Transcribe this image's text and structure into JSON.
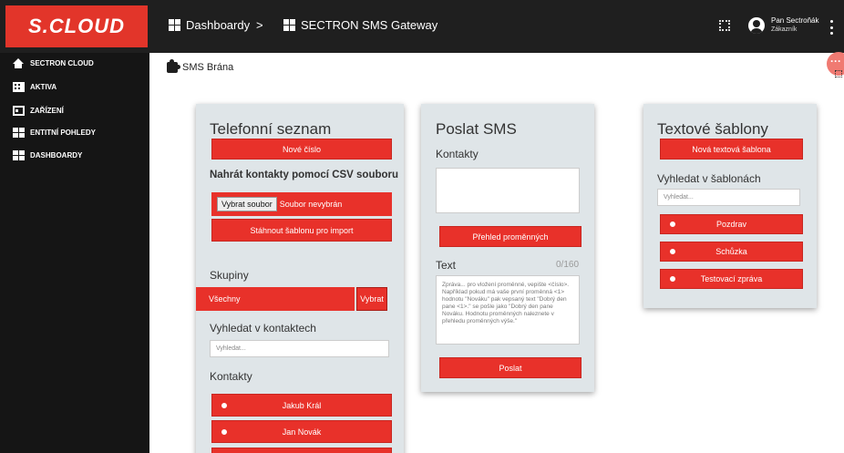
{
  "topbar": {
    "logo_text": "S.CLOUD",
    "crumb1": "Dashboardy",
    "separator": ">",
    "crumb2": "SECTRON SMS Gateway",
    "user_name": "Pan Sectroňák",
    "user_role": "Zákazník"
  },
  "sidebar": {
    "items": [
      {
        "label": "SECTRON CLOUD",
        "icon": "home-icon"
      },
      {
        "label": "AKTIVA",
        "icon": "building-icon"
      },
      {
        "label": "ZAŘÍZENÍ",
        "icon": "device-icon"
      },
      {
        "label": "ENTITNÍ POHLEDY",
        "icon": "entity-icon"
      },
      {
        "label": "DASHBOARDY",
        "icon": "dashboard-icon"
      }
    ]
  },
  "page": {
    "breadcrumb": "SMS Brána"
  },
  "phonebook": {
    "title": "Telefonní seznam",
    "new_number": "Nové číslo",
    "csv_label": "Nahrát kontakty pomocí CSV souboru",
    "choose_file": "Vybrat soubor",
    "file_status": "Soubor nevybrán",
    "download_template": "Stáhnout šablonu pro import",
    "groups_label": "Skupiny",
    "group_selected": "Všechny",
    "group_select_btn": "Vybrat",
    "search_label": "Vyhledat v kontaktech",
    "search_placeholder": "Vyhledat...",
    "contacts_label": "Kontakty",
    "contacts": [
      "Jakub Král",
      "Jan Novák"
    ]
  },
  "send_sms": {
    "title": "Poslat SMS",
    "contacts_label": "Kontakty",
    "variables_btn": "Přehled proměnných",
    "text_label": "Text",
    "counter": "0/160",
    "text_placeholder": "Zpráva... pro vložení proměnné, vepište <číslo>. Například pokud má vaše první proměnná <1> hodnotu \"Nováku\" pak vepsaný text \"Dobrý den pane <1>.\" se pošle jako \"Dobrý den pane Nováku. Hodnotu proměnných naleznete v přehledu proměnných výše.\"",
    "send_btn": "Poslat"
  },
  "templates": {
    "title": "Textové šablony",
    "new_template": "Nová textová šablona",
    "search_label": "Vyhledat v šablonách",
    "search_placeholder": "Vyhledat...",
    "items": [
      "Pozdrav",
      "Schůzka",
      "Testovací zpráva"
    ]
  },
  "colors": {
    "accent": "#e8312a",
    "topbar": "#1f1f1f",
    "sidebar": "#151515",
    "card": "#dfe5e8"
  }
}
